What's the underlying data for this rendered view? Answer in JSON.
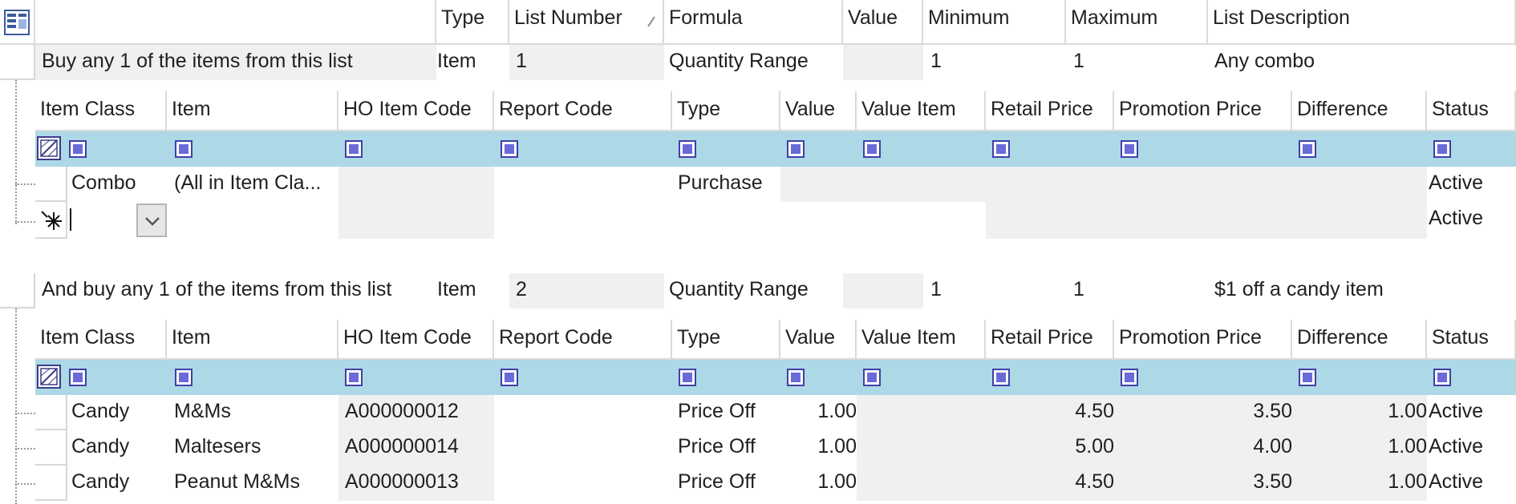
{
  "master_columns": [
    "Type",
    "List Number",
    "Formula",
    "Value",
    "Minimum",
    "Maximum",
    "List Description"
  ],
  "lists": [
    {
      "label": "Buy any 1 of the items from this list",
      "type": "Item",
      "list_number": "1",
      "formula": "Quantity Range",
      "value": "",
      "minimum": "1",
      "maximum": "1",
      "description": "Any combo"
    },
    {
      "label": "And buy any 1 of the items from this list",
      "type": "Item",
      "list_number": "2",
      "formula": "Quantity Range",
      "value": "",
      "minimum": "1",
      "maximum": "1",
      "description": "$1 off a candy item"
    }
  ],
  "detail_columns": [
    "Item Class",
    "Item",
    "HO Item Code",
    "Report Code",
    "Type",
    "Value",
    "Value Item",
    "Retail Price",
    "Promotion Price",
    "Difference",
    "Status"
  ],
  "detail1_rows": [
    {
      "item_class": "Combo",
      "item": "(All in Item Cla...",
      "ho_code": "",
      "report_code": "",
      "type": "Purchase",
      "value": "",
      "value_item": "",
      "retail": "",
      "promo": "",
      "diff": "",
      "status": "Active"
    }
  ],
  "detail1_new_row": {
    "status": "Active"
  },
  "detail2_rows": [
    {
      "item_class": "Candy",
      "item": "M&Ms",
      "ho_code": "A000000012",
      "report_code": "",
      "type": "Price Off",
      "value": "1.00",
      "value_item": "",
      "retail": "4.50",
      "promo": "3.50",
      "diff": "1.00",
      "status": "Active"
    },
    {
      "item_class": "Candy",
      "item": "Maltesers",
      "ho_code": "A000000014",
      "report_code": "",
      "type": "Price Off",
      "value": "1.00",
      "value_item": "",
      "retail": "5.00",
      "promo": "4.00",
      "diff": "1.00",
      "status": "Active"
    },
    {
      "item_class": "Candy",
      "item": "Peanut M&Ms",
      "ho_code": "A000000013",
      "report_code": "",
      "type": "Price Off",
      "value": "1.00",
      "value_item": "",
      "retail": "4.50",
      "promo": "3.50",
      "diff": "1.00",
      "status": "Active"
    }
  ],
  "icons": {
    "column_chooser": "column-chooser-icon",
    "filter_toggle": "filter-row-icon",
    "new_row": "new-row-asterisk-icon",
    "dropdown": "chevron-down-icon"
  },
  "colors": {
    "filter_row": "#add8e6",
    "readonly_cell": "#f0f0f0",
    "checkbox": "#4040a8"
  }
}
